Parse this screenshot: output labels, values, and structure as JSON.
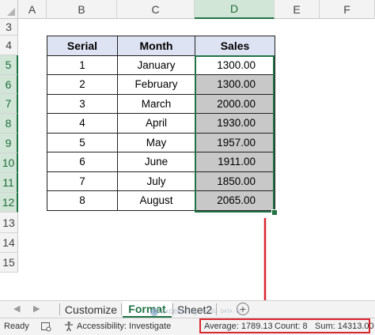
{
  "columns": [
    "A",
    "B",
    "C",
    "D",
    "E",
    "F"
  ],
  "selected_column": "D",
  "rows": [
    "3",
    "4",
    "5",
    "6",
    "7",
    "8",
    "9",
    "10",
    "11",
    "12",
    "13",
    "14",
    "15"
  ],
  "table": {
    "headers": {
      "serial": "Serial",
      "month": "Month",
      "sales": "Sales"
    },
    "rows": [
      {
        "serial": "1",
        "month": "January",
        "sales": "1300.00"
      },
      {
        "serial": "2",
        "month": "February",
        "sales": "1300.00"
      },
      {
        "serial": "3",
        "month": "March",
        "sales": "2000.00"
      },
      {
        "serial": "4",
        "month": "April",
        "sales": "1930.00"
      },
      {
        "serial": "5",
        "month": "May",
        "sales": "1957.00"
      },
      {
        "serial": "6",
        "month": "June",
        "sales": "1911.00"
      },
      {
        "serial": "7",
        "month": "July",
        "sales": "1850.00"
      },
      {
        "serial": "8",
        "month": "August",
        "sales": "2065.00"
      }
    ]
  },
  "sheet_tabs": {
    "nav_prev": "◀",
    "nav_next": "▶",
    "items": [
      {
        "label": "Customize",
        "active": false
      },
      {
        "label": "Format",
        "active": true
      },
      {
        "label": "Sheet2",
        "active": false
      }
    ],
    "add_icon": "+"
  },
  "watermark": {
    "name": "exceldemy",
    "tagline": "EXCEL · DATA · BI"
  },
  "status": {
    "ready": "Ready",
    "accessibility": "Accessibility: Investigate",
    "average": "Average: 1789.13",
    "count": "Count: 8",
    "sum": "Sum: 14313.00"
  },
  "colors": {
    "accent": "#217346",
    "highlight": "#d9272e",
    "header_fill": "#dde3f2",
    "selection_fill": "#c8c8c8"
  }
}
